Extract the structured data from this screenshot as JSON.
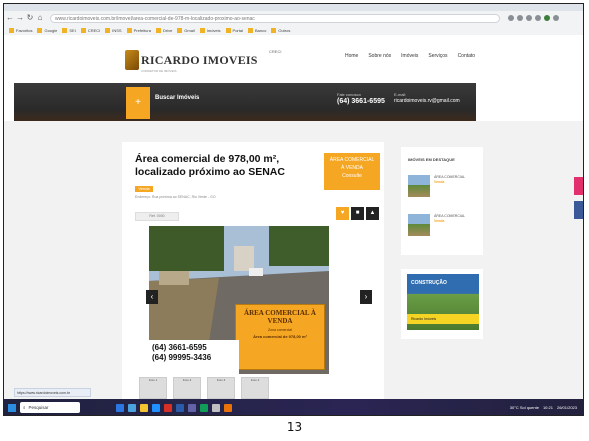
{
  "browser": {
    "address": "www.ricardoimoveis.com.br/imovel/area-comercial-de-978-m-localizado-proximo-ao-senac",
    "bookmarks": [
      "Favoritos",
      "Google",
      "SEI",
      "CRECI",
      "INSS",
      "Prefeitura",
      "Drive",
      "Gmail",
      "Imóveis",
      "Portal",
      "Banco",
      "Outros"
    ]
  },
  "site": {
    "logo_text": "RICARDO IMOVEIS",
    "logo_sub": "CORRETOR DE IMÓVEIS",
    "creci": "CRECI",
    "nav": [
      "Home",
      "Sobre nós",
      "Imóveis",
      "Serviços",
      "Contato"
    ],
    "search_label": "Buscar Imóveis",
    "phone_caption": "Fale conosco",
    "phone": "(64) 3661-6595",
    "email_caption": "E-mail",
    "email": "ricardoimoveis.rv@gmail.com"
  },
  "listing": {
    "title": "Área comercial de 978,00 m², localizado próximo ao SENAC",
    "price_box": [
      "ÁREA COMERCIAL",
      "À VENDA",
      "Consulte"
    ],
    "badge": "Venda",
    "address": "Endereço: Rua próxima ao SENAC, Rio Verde - GO",
    "ref": "Ref. 0000",
    "photo_sign": {
      "heading": "ÁREA COMERCIAL À VENDA",
      "sub": "Zona comercial",
      "area": "Área comercial de 978,00 m²",
      "phone1": "(64) 3661-6595",
      "phone2": "(64) 99995-3436"
    },
    "thumbs": [
      "Foto 1",
      "Foto 2",
      "Foto 3",
      "Foto 4"
    ]
  },
  "sidebar": {
    "title": "IMÓVEIS EM DESTAQUE",
    "items": [
      {
        "name": "ÁREA COMERCIAL",
        "price": "Venda"
      },
      {
        "name": "ÁREA COMERCIAL",
        "price": "Venda"
      }
    ],
    "ad_text": "CONSTRUÇÃO",
    "ad_band": "Ricardo Imóveis"
  },
  "taskbar": {
    "search_placeholder": "Pesquisar",
    "tooltip": "https://www.ricardoimoveis.com.br",
    "weather": "30°C Sol quente",
    "time": "10:21",
    "date": "26/01/2023"
  },
  "page_number": "13",
  "colors": {
    "accent": "#f5a623",
    "dark": "#2a2a2a"
  }
}
